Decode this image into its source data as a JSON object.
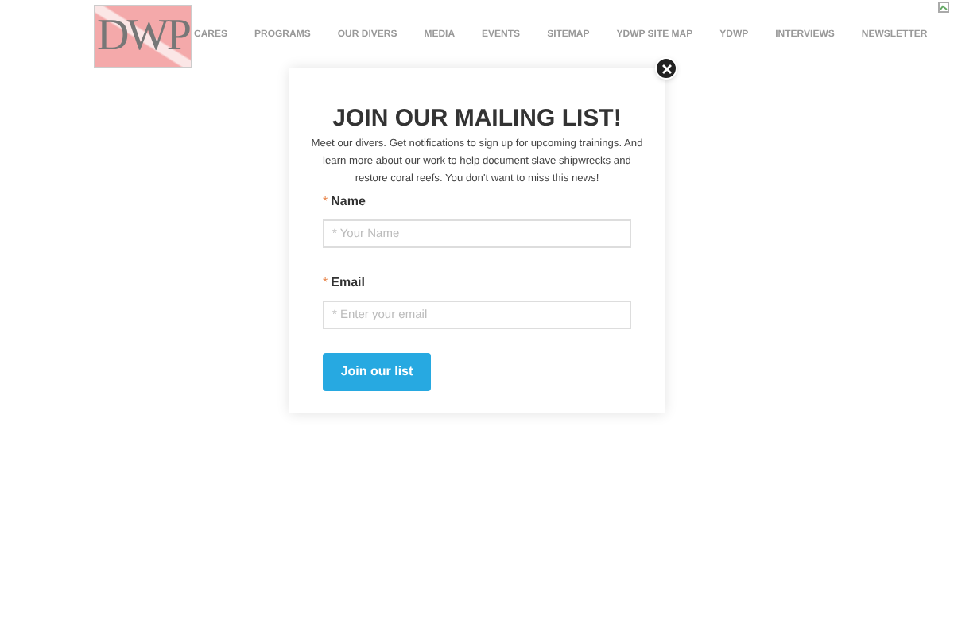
{
  "logo": {
    "text": "DWP"
  },
  "nav": [
    "CARES",
    "PROGRAMS",
    "OUR DIVERS",
    "MEDIA",
    "EVENTS",
    "SITEMAP",
    "YDWP SITE MAP",
    "YDWP",
    "INTERVIEWS",
    "NEWSLETTER"
  ],
  "popup": {
    "title": "JOIN OUR MAILING LIST!",
    "description": "Meet our divers. Get notifications to sign up for upcoming trainings. And learn more about our work to help document slave shipwrecks and restore coral reefs. You don't want to miss this news!",
    "fields": [
      {
        "required_mark": "*",
        "label": "Name",
        "placeholder": "* Your Name"
      },
      {
        "required_mark": "*",
        "label": "Email",
        "placeholder": "* Enter your email"
      }
    ],
    "submit": "Join our list"
  }
}
